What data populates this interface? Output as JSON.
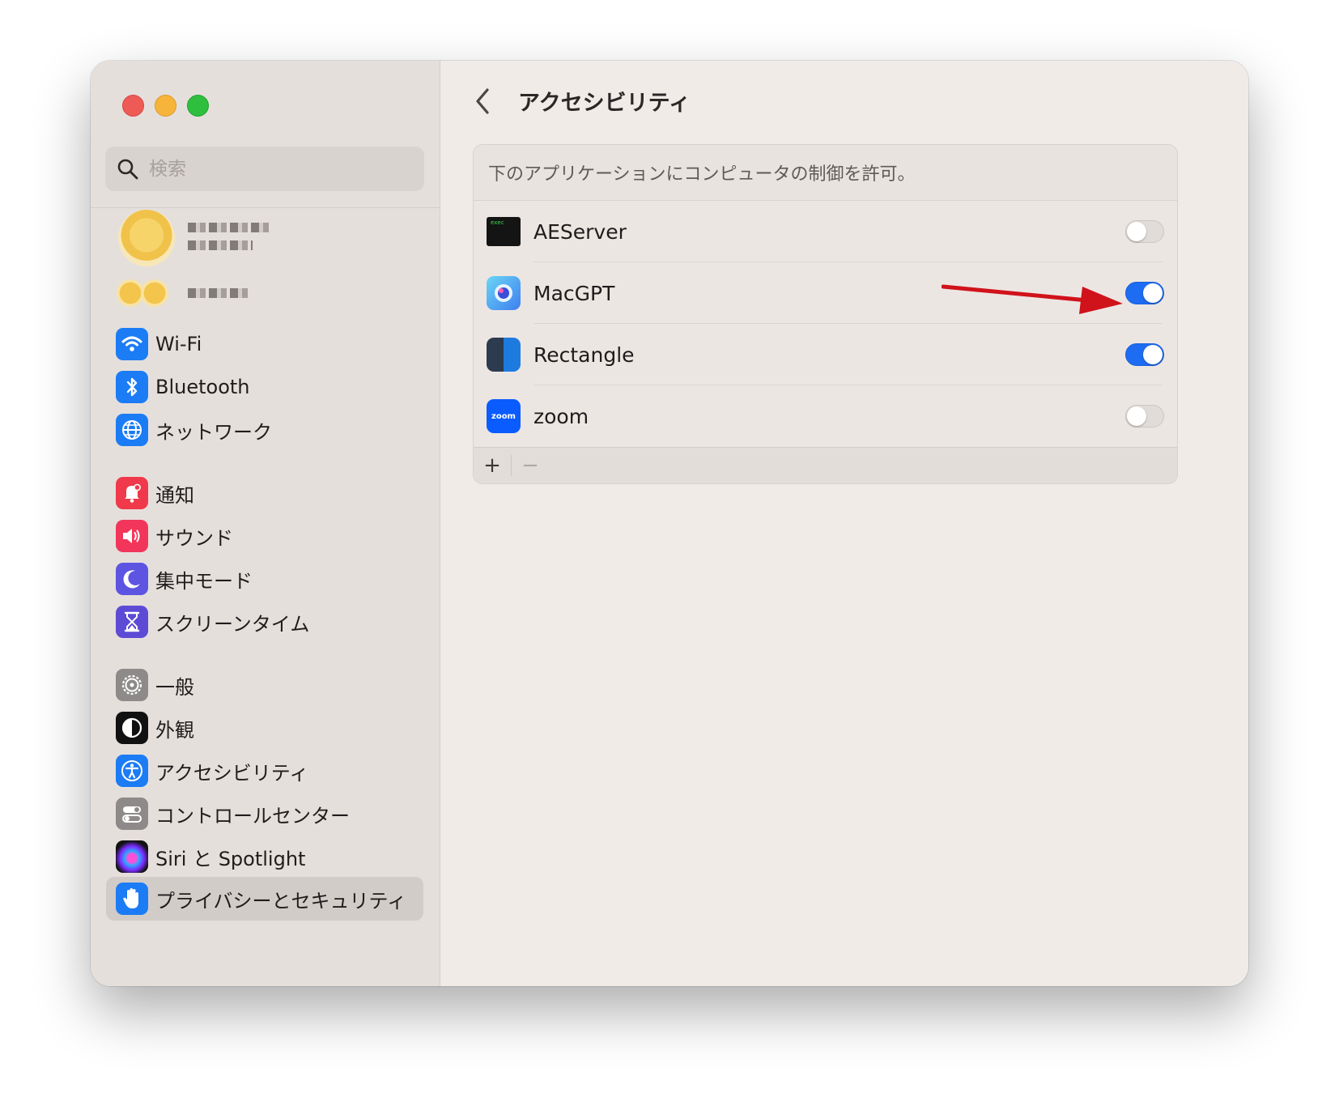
{
  "sidebar": {
    "search_placeholder": "検索",
    "items": [
      {
        "label": "Wi-Fi",
        "icon": "wifi-icon"
      },
      {
        "label": "Bluetooth",
        "icon": "bluetooth-icon"
      },
      {
        "label": "ネットワーク",
        "icon": "network-globe-icon"
      },
      {
        "label": "通知",
        "icon": "notification-bell-icon"
      },
      {
        "label": "サウンド",
        "icon": "speaker-icon"
      },
      {
        "label": "集中モード",
        "icon": "moon-icon"
      },
      {
        "label": "スクリーンタイム",
        "icon": "hourglass-icon"
      },
      {
        "label": "一般",
        "icon": "gear-icon"
      },
      {
        "label": "外観",
        "icon": "appearance-icon"
      },
      {
        "label": "アクセシビリティ",
        "icon": "accessibility-icon"
      },
      {
        "label": "コントロールセンター",
        "icon": "control-center-icon"
      },
      {
        "label": "Siri と Spotlight",
        "icon": "siri-icon"
      },
      {
        "label": "プライバシーとセキュリティ",
        "icon": "hand-icon",
        "selected": true
      }
    ]
  },
  "main": {
    "title": "アクセシビリティ",
    "panel_header": "下のアプリケーションにコンピュータの制御を許可。",
    "apps": [
      {
        "name": "AEServer",
        "enabled": false,
        "icon": "terminal-exec-icon"
      },
      {
        "name": "MacGPT",
        "enabled": true,
        "icon": "macgpt-icon"
      },
      {
        "name": "Rectangle",
        "enabled": true,
        "icon": "rectangle-icon"
      },
      {
        "name": "zoom",
        "enabled": false,
        "icon": "zoom-icon"
      }
    ],
    "footer": {
      "add": "+",
      "remove": "−"
    }
  },
  "colors": {
    "toggle_on": "#1d6cf1",
    "annotation_arrow": "#d0121b",
    "sidebar_bg": "#e5dfdc",
    "content_bg": "#f1ebe8"
  }
}
